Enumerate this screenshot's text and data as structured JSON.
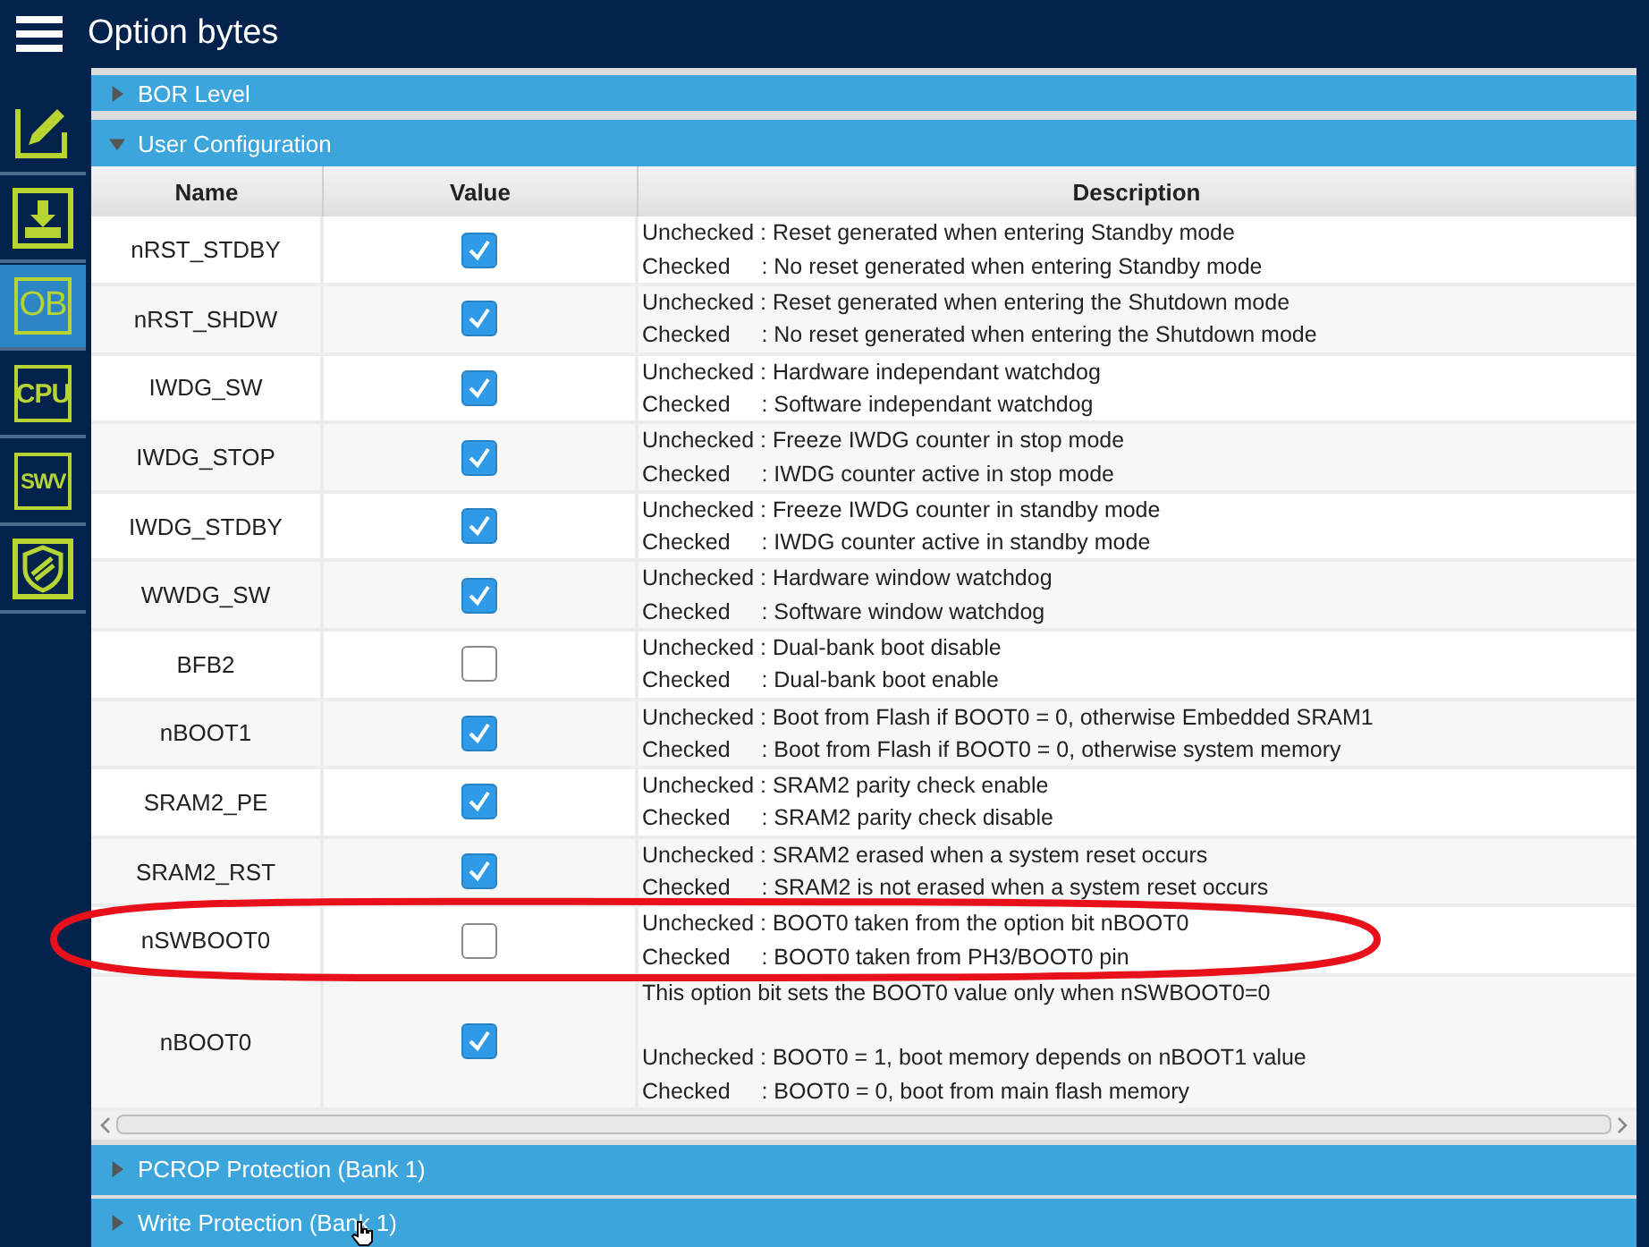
{
  "header": {
    "title": "Option bytes"
  },
  "sidebar": [
    {
      "kind": "pencil",
      "selected": false
    },
    {
      "kind": "download",
      "selected": false
    },
    {
      "kind": "text",
      "label": "OB",
      "selected": true
    },
    {
      "kind": "text",
      "label": "CPU",
      "selected": false
    },
    {
      "kind": "text",
      "label": "SWV",
      "selected": false
    },
    {
      "kind": "shield",
      "selected": false
    }
  ],
  "sections_top": [
    {
      "title": "BOR Level",
      "expanded": false
    },
    {
      "title": "User Configuration",
      "expanded": true
    }
  ],
  "table": {
    "columns": [
      "Name",
      "Value",
      "Description"
    ],
    "rows": [
      {
        "name": "nRST_STDBY",
        "checked": true,
        "lines": [
          "Unchecked : Reset generated when entering Standby mode",
          "Checked     : No reset generated when entering Standby mode"
        ]
      },
      {
        "name": "nRST_SHDW",
        "checked": true,
        "lines": [
          "Unchecked : Reset generated when entering the Shutdown mode",
          "Checked     : No reset generated when entering the Shutdown mode"
        ]
      },
      {
        "name": "IWDG_SW",
        "checked": true,
        "lines": [
          "Unchecked : Hardware independant watchdog",
          "Checked     : Software independant watchdog"
        ]
      },
      {
        "name": "IWDG_STOP",
        "checked": true,
        "lines": [
          "Unchecked : Freeze IWDG counter in stop mode",
          "Checked     : IWDG counter active in stop mode"
        ]
      },
      {
        "name": "IWDG_STDBY",
        "checked": true,
        "lines": [
          "Unchecked : Freeze IWDG counter in standby mode",
          "Checked     : IWDG counter active in standby mode"
        ]
      },
      {
        "name": "WWDG_SW",
        "checked": true,
        "lines": [
          "Unchecked : Hardware window watchdog",
          "Checked     : Software window watchdog"
        ]
      },
      {
        "name": "BFB2",
        "checked": false,
        "lines": [
          "Unchecked : Dual-bank boot disable",
          "Checked     : Dual-bank boot enable"
        ]
      },
      {
        "name": "nBOOT1",
        "checked": true,
        "lines": [
          "Unchecked : Boot from Flash if BOOT0 = 0, otherwise Embedded SRAM1",
          "Checked     : Boot from Flash if BOOT0 = 0, otherwise system memory"
        ]
      },
      {
        "name": "SRAM2_PE",
        "checked": true,
        "lines": [
          "Unchecked : SRAM2 parity check enable",
          "Checked     : SRAM2 parity check disable"
        ]
      },
      {
        "name": "SRAM2_RST",
        "checked": true,
        "lines": [
          "Unchecked : SRAM2 erased when a system reset occurs",
          "Checked     : SRAM2 is not erased when a system reset occurs"
        ]
      },
      {
        "name": "nSWBOOT0",
        "checked": false,
        "lines": [
          "Unchecked : BOOT0 taken from the option bit nBOOT0",
          "Checked     : BOOT0 taken from PH3/BOOT0 pin"
        ]
      },
      {
        "name": "nBOOT0",
        "checked": true,
        "note": "This option bit sets the BOOT0 value only when nSWBOOT0=0",
        "lines": [
          "Unchecked : BOOT0 = 1, boot memory depends on nBOOT1 value",
          "Checked     : BOOT0 = 0, boot from main flash memory"
        ]
      }
    ]
  },
  "sections_bottom": [
    {
      "title": "PCROP Protection (Bank 1)",
      "expanded": false
    },
    {
      "title": "Write Protection (Bank 1)",
      "expanded": false
    }
  ],
  "annotation": {
    "kind": "ellipse"
  }
}
